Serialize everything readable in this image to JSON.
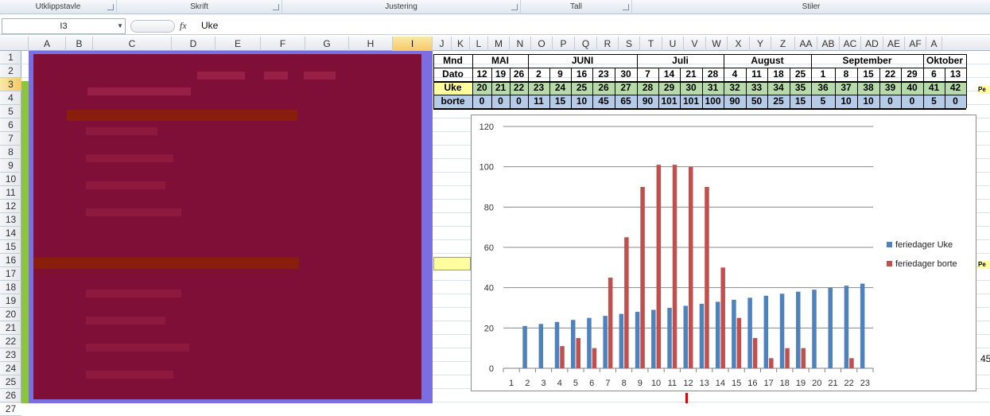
{
  "ribbon": {
    "groups": [
      {
        "label": "Utklippstavle"
      },
      {
        "label": "Skrift"
      },
      {
        "label": "Justering"
      },
      {
        "label": "Tall"
      },
      {
        "label": "Stiler"
      }
    ]
  },
  "formula_bar": {
    "name_box": "I3",
    "fx": "fx",
    "value": "Uke"
  },
  "columns": [
    "A",
    "B",
    "C",
    "D",
    "E",
    "F",
    "G",
    "H",
    "I",
    "J",
    "K",
    "L",
    "M",
    "N",
    "O",
    "P",
    "Q",
    "R",
    "S",
    "T",
    "U",
    "V",
    "W",
    "X",
    "Y",
    "Z",
    "AA",
    "AB",
    "AC",
    "AD",
    "AE",
    "AF",
    "A"
  ],
  "rows": [
    "1",
    "2",
    "3",
    "4",
    "5",
    "6",
    "7",
    "8",
    "9",
    "10",
    "11",
    "12",
    "13",
    "14",
    "15",
    "16",
    "17",
    "18",
    "19",
    "20",
    "21",
    "22",
    "23",
    "24",
    "25",
    "26",
    "27"
  ],
  "sheet": {
    "mnd_label": "Mnd",
    "dato_label": "Dato",
    "uke_label": "Uke",
    "borte_label": "borte",
    "months": [
      {
        "name": "MAI"
      },
      {
        "name": "JUNI"
      },
      {
        "name": "Juli"
      },
      {
        "name": "August"
      },
      {
        "name": "September"
      },
      {
        "name": "Oktober"
      }
    ],
    "dates": [
      "12",
      "19",
      "26",
      "2",
      "9",
      "16",
      "23",
      "30",
      "7",
      "14",
      "21",
      "28",
      "4",
      "11",
      "18",
      "25",
      "1",
      "8",
      "15",
      "22",
      "29",
      "6",
      "13"
    ],
    "weeks": [
      "20",
      "21",
      "22",
      "23",
      "24",
      "25",
      "26",
      "27",
      "28",
      "29",
      "30",
      "31",
      "32",
      "33",
      "34",
      "35",
      "36",
      "37",
      "38",
      "39",
      "40",
      "41",
      "42"
    ],
    "borte": [
      "0",
      "0",
      "0",
      "11",
      "15",
      "10",
      "45",
      "65",
      "90",
      "101",
      "101",
      "100",
      "90",
      "50",
      "25",
      "15",
      "5",
      "10",
      "10",
      "0",
      "0",
      "5",
      "0"
    ],
    "side_label_3": "Pe",
    "side_label_17": "Pe",
    "side_value_24": "45"
  },
  "chart_data": {
    "type": "bar",
    "categories": [
      "1",
      "2",
      "3",
      "4",
      "5",
      "6",
      "7",
      "8",
      "9",
      "10",
      "11",
      "12",
      "13",
      "14",
      "15",
      "16",
      "17",
      "18",
      "19",
      "20",
      "21",
      "22",
      "23"
    ],
    "series": [
      {
        "name": "feriedager Uke",
        "color": "#4f81bd",
        "values": [
          null,
          21,
          22,
          23,
          24,
          25,
          26,
          27,
          28,
          29,
          30,
          31,
          32,
          33,
          34,
          35,
          36,
          37,
          38,
          39,
          40,
          41,
          42
        ]
      },
      {
        "name": "feriedager borte",
        "color": "#c0504d",
        "values": [
          null,
          null,
          null,
          11,
          15,
          10,
          45,
          65,
          90,
          101,
          101,
          100,
          90,
          50,
          25,
          15,
          5,
          10,
          10,
          null,
          null,
          5,
          null
        ]
      }
    ],
    "yticks": [
      "0",
      "20",
      "40",
      "60",
      "80",
      "100",
      "120"
    ],
    "ylim": [
      0,
      120
    ],
    "grid": true,
    "legend_position": "right",
    "title": "",
    "xlabel": "",
    "ylabel": ""
  }
}
